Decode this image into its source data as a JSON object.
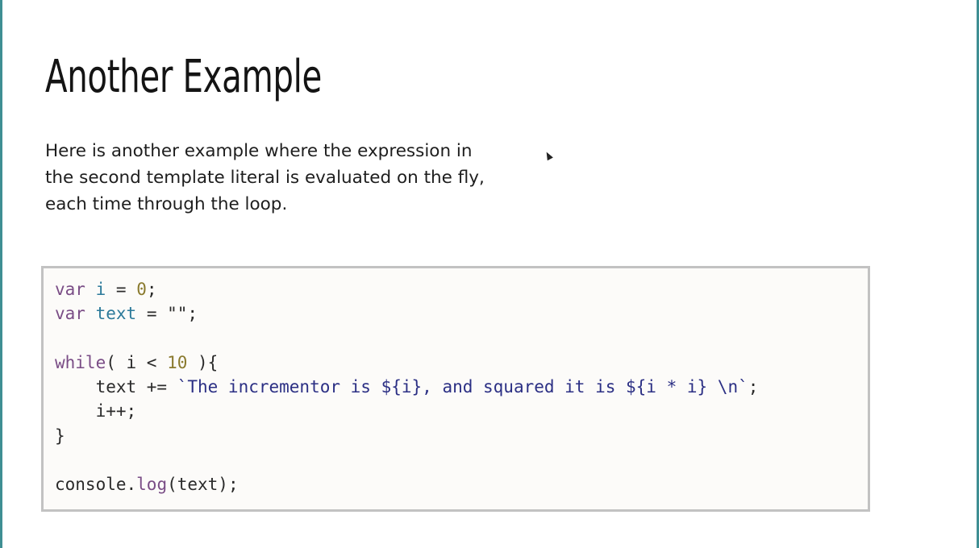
{
  "slide": {
    "title": "Another Example",
    "body_lines": [
      "Here is another example where the expression in",
      "the second template literal is evaluated on the fly,",
      "each time through the loop."
    ]
  },
  "code": {
    "lines": [
      [
        {
          "t": "var",
          "c": "kw"
        },
        {
          "t": " "
        },
        {
          "t": "i",
          "c": "var"
        },
        {
          "t": " = "
        },
        {
          "t": "0",
          "c": "num"
        },
        {
          "t": ";"
        }
      ],
      [
        {
          "t": "var",
          "c": "kw"
        },
        {
          "t": " "
        },
        {
          "t": "text",
          "c": "var"
        },
        {
          "t": " = \"\";"
        }
      ],
      [],
      [
        {
          "t": "while",
          "c": "kw"
        },
        {
          "t": "( i < "
        },
        {
          "t": "10",
          "c": "num"
        },
        {
          "t": " ){"
        }
      ],
      [
        {
          "t": "    text += "
        },
        {
          "t": "`The incrementor is ${i}, and squared it is ${i * i} \\n`",
          "c": "str"
        },
        {
          "t": ";"
        }
      ],
      [
        {
          "t": "    i++;"
        }
      ],
      [
        {
          "t": "}"
        }
      ],
      [],
      [
        {
          "t": "console."
        },
        {
          "t": "log",
          "c": "fn"
        },
        {
          "t": "(text);"
        }
      ]
    ]
  },
  "colors": {
    "edge": "#3f8f93",
    "keyword": "#7a4d86",
    "variable": "#2c7a9a",
    "number": "#8a7a2e",
    "string": "#2b2f84"
  }
}
